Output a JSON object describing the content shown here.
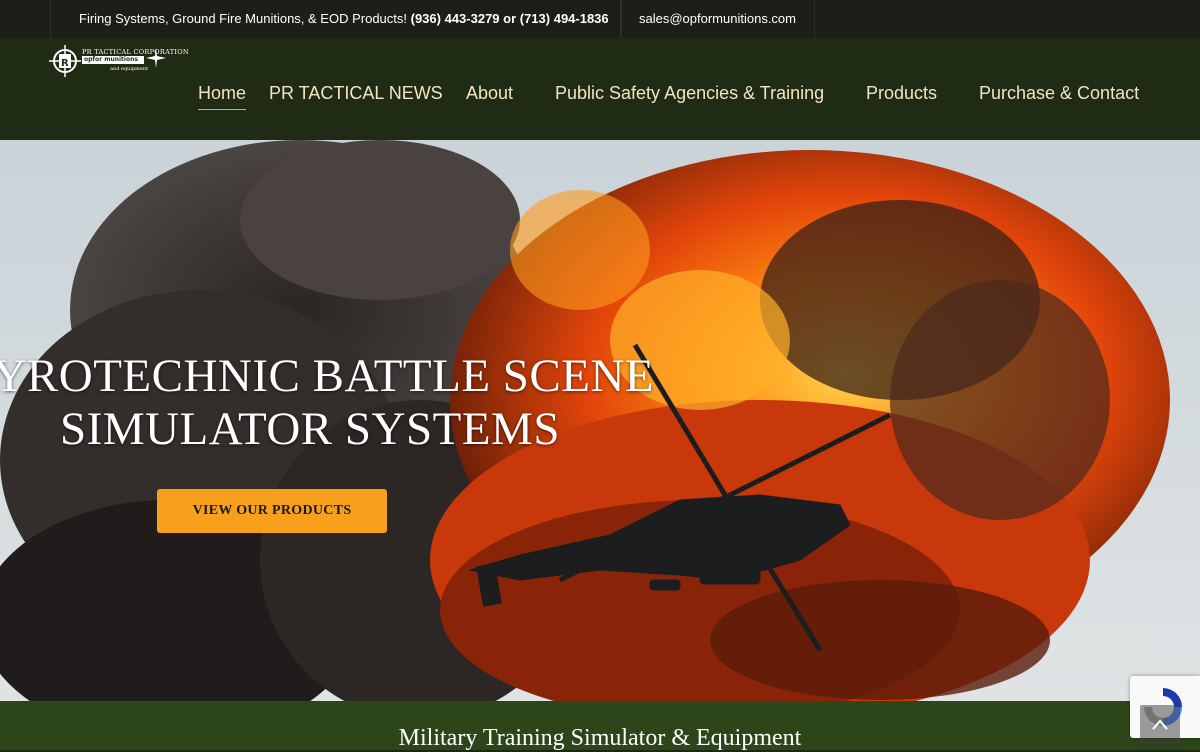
{
  "topbar": {
    "info_text": "Firing Systems, Ground Fire Munitions, & EOD Products!",
    "phones": "(936) 443-3279 or (713) 494-1836",
    "email": "sales@opformunitions.com"
  },
  "logo": {
    "line1": "PR TACTICAL CORPORATION",
    "line2": "opfor munitions",
    "line3": "and equipment"
  },
  "nav": {
    "items": [
      {
        "label": "Home"
      },
      {
        "label": "PR TACTICAL NEWS"
      },
      {
        "label": "About"
      },
      {
        "label": "Public Safety Agencies & Training"
      },
      {
        "label": "Products"
      },
      {
        "label": "Purchase & Contact"
      }
    ]
  },
  "hero": {
    "title_line1": "PYROTECHNIC BATTLE SCENE",
    "title_line2": "SIMULATOR SYSTEMS",
    "cta_label": "VIEW OUR PRODUCTS"
  },
  "band": {
    "title": "Military Training Simulator & Equipment"
  },
  "colors": {
    "topbar_bg": "#1b1f18",
    "header_bg": "#1f2b14",
    "nav_text": "#f4e4c2",
    "accent": "#f6a01b",
    "band_bg": "#2d4619"
  },
  "icons": [
    "logo-crosshair-icon",
    "recaptcha-icon",
    "scroll-to-top-icon"
  ]
}
